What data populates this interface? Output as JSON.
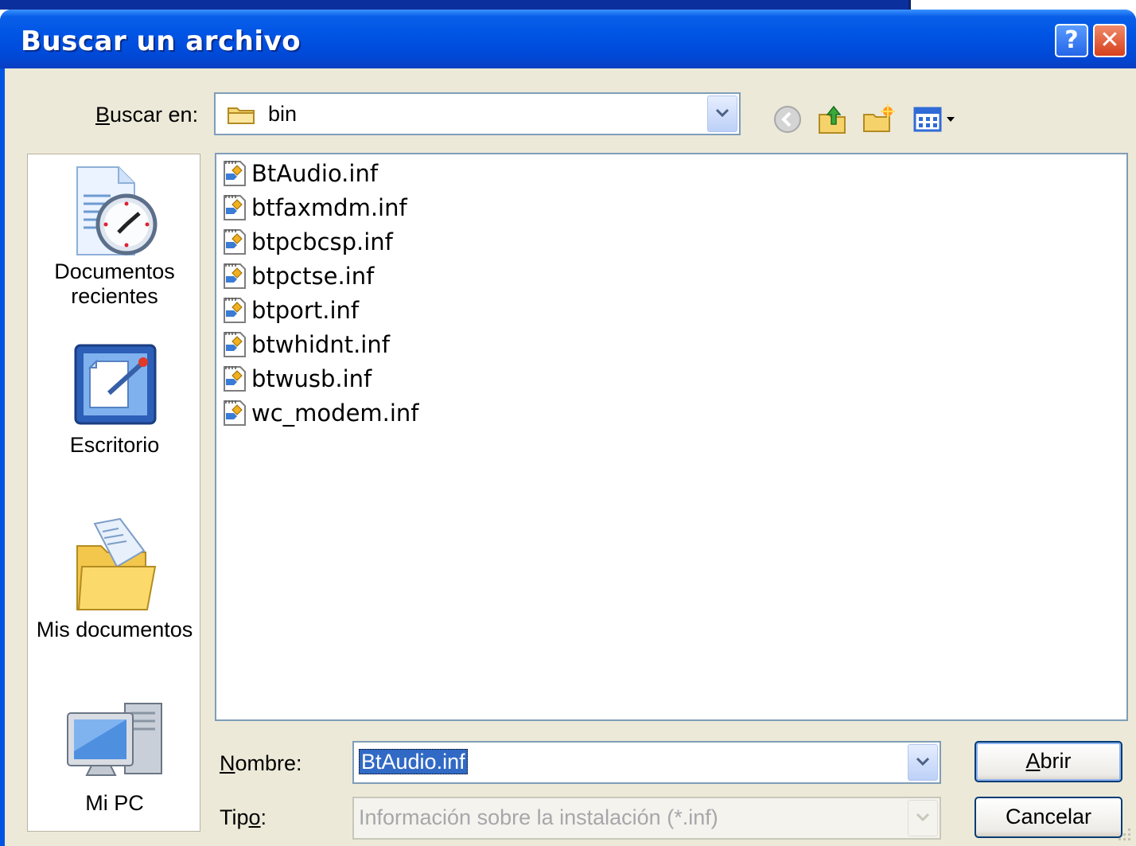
{
  "window": {
    "title": "Buscar un archivo",
    "help_label": "?",
    "close_label": "✕"
  },
  "lookin": {
    "label_prefix": "",
    "label_underlined": "B",
    "label_rest": "uscar en:",
    "value": "bin"
  },
  "toolbar": {
    "icons": [
      "back-icon",
      "up-folder-icon",
      "new-folder-icon",
      "views-menu-icon"
    ]
  },
  "places": [
    {
      "line1": "Documentos",
      "line2": "recientes",
      "icon": "recent-documents-icon"
    },
    {
      "line1": "Escritorio",
      "line2": "",
      "icon": "desktop-icon"
    },
    {
      "line1": "Mis documentos",
      "line2": "",
      "icon": "my-documents-icon"
    },
    {
      "line1": "Mi PC",
      "line2": "",
      "icon": "my-computer-icon"
    }
  ],
  "files": [
    "BtAudio.inf",
    "btfaxmdm.inf",
    "btpcbcsp.inf",
    "btpctse.inf",
    "btport.inf",
    "btwhidnt.inf",
    "btwusb.inf",
    "wc_modem.inf"
  ],
  "filename": {
    "label_underlined": "N",
    "label_rest": "ombre:",
    "value": "BtAudio.inf"
  },
  "filetype": {
    "label_prefix": "Tip",
    "label_underlined": "o",
    "label_rest": ":",
    "value": "Información sobre la instalación (*.inf)"
  },
  "buttons": {
    "open_underlined": "A",
    "open_rest": "brir",
    "cancel": "Cancelar"
  },
  "colors": {
    "titlebar": "#0054e3",
    "client": "#ece9d8",
    "selection": "#316ac5"
  }
}
